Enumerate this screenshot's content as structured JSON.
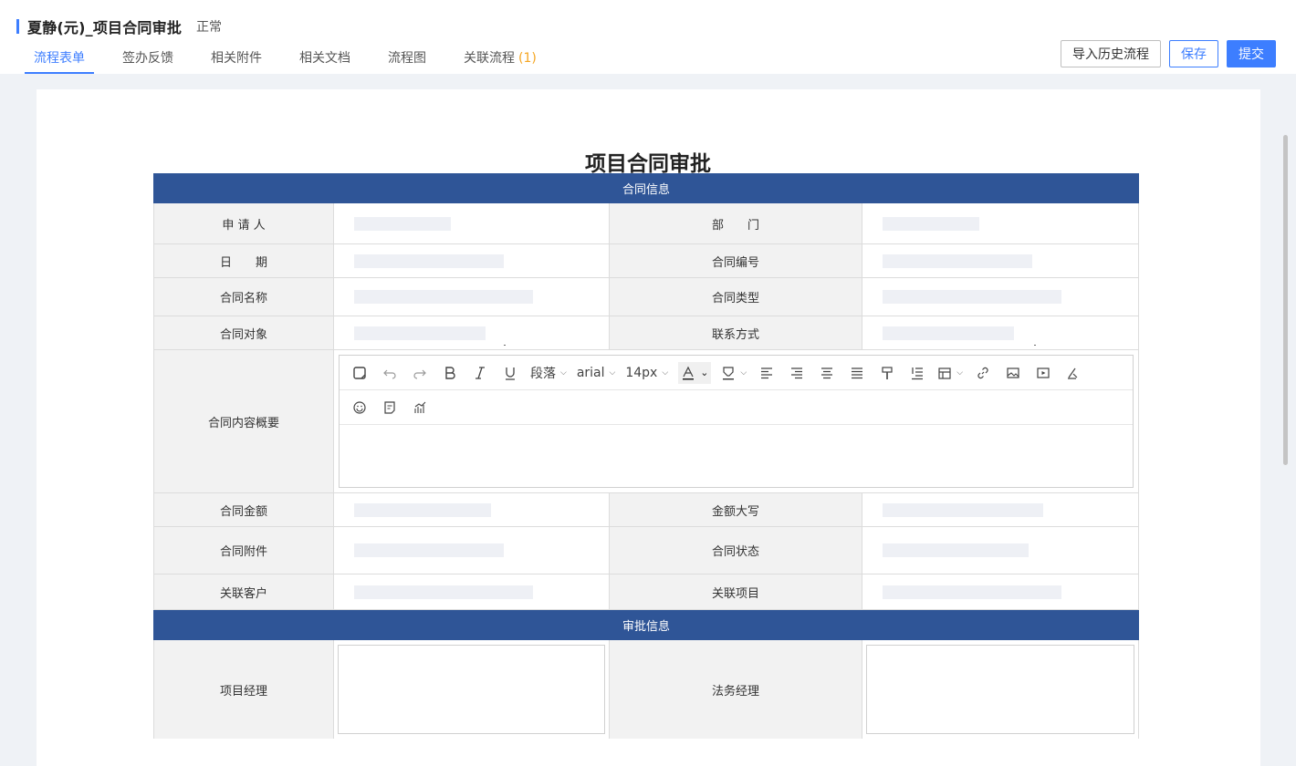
{
  "header": {
    "title": "夏静(元)_项目合同审批",
    "status": "正常",
    "tabs": [
      {
        "label": "流程表单"
      },
      {
        "label": "签办反馈"
      },
      {
        "label": "相关附件"
      },
      {
        "label": "相关文档"
      },
      {
        "label": "流程图"
      },
      {
        "label": "关联流程",
        "count": "(1)"
      }
    ],
    "actions": {
      "import_label": "导入历史流程",
      "save_label": "保存",
      "submit_label": "提交"
    }
  },
  "form": {
    "title": "项目合同审批",
    "section_contract": "合同信息",
    "labels": {
      "applicant": "申 请 人",
      "department": "部　　门",
      "date": "日　　期",
      "contract_no": "合同编号",
      "contract_name": "合同名称",
      "contract_type": "合同类型",
      "contract_target": "合同对象",
      "contact": "联系方式",
      "summary": "合同内容概要",
      "amount": "合同金额",
      "amount_upper": "金额大写",
      "attachment": "合同附件",
      "contract_status": "合同状态",
      "customer": "关联客户",
      "project": "关联项目"
    },
    "editor": {
      "paragraph": "段落",
      "font": "arial",
      "size": "14px"
    },
    "section_approval": "审批信息",
    "approval_labels": {
      "pm": "项目经理",
      "legal": "法务经理"
    }
  },
  "colors": {
    "accent": "#3d7eff",
    "section_header": "#2f5597",
    "badge": "#f5a623"
  }
}
